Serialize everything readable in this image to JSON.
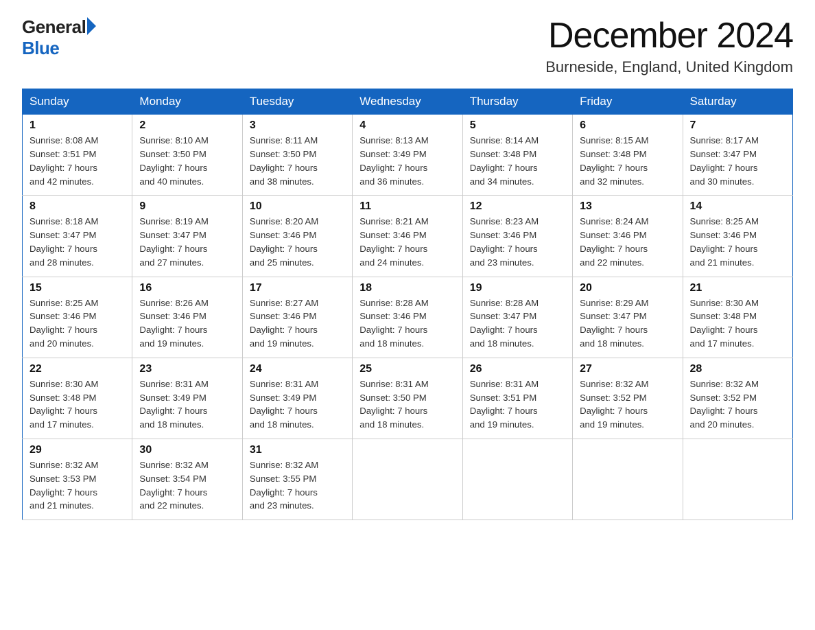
{
  "header": {
    "logo_general": "General",
    "logo_blue": "Blue",
    "title": "December 2024",
    "subtitle": "Burneside, England, United Kingdom"
  },
  "days_of_week": [
    "Sunday",
    "Monday",
    "Tuesday",
    "Wednesday",
    "Thursday",
    "Friday",
    "Saturday"
  ],
  "weeks": [
    [
      {
        "num": "1",
        "sunrise": "8:08 AM",
        "sunset": "3:51 PM",
        "daylight": "7 hours and 42 minutes."
      },
      {
        "num": "2",
        "sunrise": "8:10 AM",
        "sunset": "3:50 PM",
        "daylight": "7 hours and 40 minutes."
      },
      {
        "num": "3",
        "sunrise": "8:11 AM",
        "sunset": "3:50 PM",
        "daylight": "7 hours and 38 minutes."
      },
      {
        "num": "4",
        "sunrise": "8:13 AM",
        "sunset": "3:49 PM",
        "daylight": "7 hours and 36 minutes."
      },
      {
        "num": "5",
        "sunrise": "8:14 AM",
        "sunset": "3:48 PM",
        "daylight": "7 hours and 34 minutes."
      },
      {
        "num": "6",
        "sunrise": "8:15 AM",
        "sunset": "3:48 PM",
        "daylight": "7 hours and 32 minutes."
      },
      {
        "num": "7",
        "sunrise": "8:17 AM",
        "sunset": "3:47 PM",
        "daylight": "7 hours and 30 minutes."
      }
    ],
    [
      {
        "num": "8",
        "sunrise": "8:18 AM",
        "sunset": "3:47 PM",
        "daylight": "7 hours and 28 minutes."
      },
      {
        "num": "9",
        "sunrise": "8:19 AM",
        "sunset": "3:47 PM",
        "daylight": "7 hours and 27 minutes."
      },
      {
        "num": "10",
        "sunrise": "8:20 AM",
        "sunset": "3:46 PM",
        "daylight": "7 hours and 25 minutes."
      },
      {
        "num": "11",
        "sunrise": "8:21 AM",
        "sunset": "3:46 PM",
        "daylight": "7 hours and 24 minutes."
      },
      {
        "num": "12",
        "sunrise": "8:23 AM",
        "sunset": "3:46 PM",
        "daylight": "7 hours and 23 minutes."
      },
      {
        "num": "13",
        "sunrise": "8:24 AM",
        "sunset": "3:46 PM",
        "daylight": "7 hours and 22 minutes."
      },
      {
        "num": "14",
        "sunrise": "8:25 AM",
        "sunset": "3:46 PM",
        "daylight": "7 hours and 21 minutes."
      }
    ],
    [
      {
        "num": "15",
        "sunrise": "8:25 AM",
        "sunset": "3:46 PM",
        "daylight": "7 hours and 20 minutes."
      },
      {
        "num": "16",
        "sunrise": "8:26 AM",
        "sunset": "3:46 PM",
        "daylight": "7 hours and 19 minutes."
      },
      {
        "num": "17",
        "sunrise": "8:27 AM",
        "sunset": "3:46 PM",
        "daylight": "7 hours and 19 minutes."
      },
      {
        "num": "18",
        "sunrise": "8:28 AM",
        "sunset": "3:46 PM",
        "daylight": "7 hours and 18 minutes."
      },
      {
        "num": "19",
        "sunrise": "8:28 AM",
        "sunset": "3:47 PM",
        "daylight": "7 hours and 18 minutes."
      },
      {
        "num": "20",
        "sunrise": "8:29 AM",
        "sunset": "3:47 PM",
        "daylight": "7 hours and 18 minutes."
      },
      {
        "num": "21",
        "sunrise": "8:30 AM",
        "sunset": "3:48 PM",
        "daylight": "7 hours and 17 minutes."
      }
    ],
    [
      {
        "num": "22",
        "sunrise": "8:30 AM",
        "sunset": "3:48 PM",
        "daylight": "7 hours and 17 minutes."
      },
      {
        "num": "23",
        "sunrise": "8:31 AM",
        "sunset": "3:49 PM",
        "daylight": "7 hours and 18 minutes."
      },
      {
        "num": "24",
        "sunrise": "8:31 AM",
        "sunset": "3:49 PM",
        "daylight": "7 hours and 18 minutes."
      },
      {
        "num": "25",
        "sunrise": "8:31 AM",
        "sunset": "3:50 PM",
        "daylight": "7 hours and 18 minutes."
      },
      {
        "num": "26",
        "sunrise": "8:31 AM",
        "sunset": "3:51 PM",
        "daylight": "7 hours and 19 minutes."
      },
      {
        "num": "27",
        "sunrise": "8:32 AM",
        "sunset": "3:52 PM",
        "daylight": "7 hours and 19 minutes."
      },
      {
        "num": "28",
        "sunrise": "8:32 AM",
        "sunset": "3:52 PM",
        "daylight": "7 hours and 20 minutes."
      }
    ],
    [
      {
        "num": "29",
        "sunrise": "8:32 AM",
        "sunset": "3:53 PM",
        "daylight": "7 hours and 21 minutes."
      },
      {
        "num": "30",
        "sunrise": "8:32 AM",
        "sunset": "3:54 PM",
        "daylight": "7 hours and 22 minutes."
      },
      {
        "num": "31",
        "sunrise": "8:32 AM",
        "sunset": "3:55 PM",
        "daylight": "7 hours and 23 minutes."
      },
      null,
      null,
      null,
      null
    ]
  ],
  "labels": {
    "sunrise": "Sunrise:",
    "sunset": "Sunset:",
    "daylight": "Daylight:"
  }
}
